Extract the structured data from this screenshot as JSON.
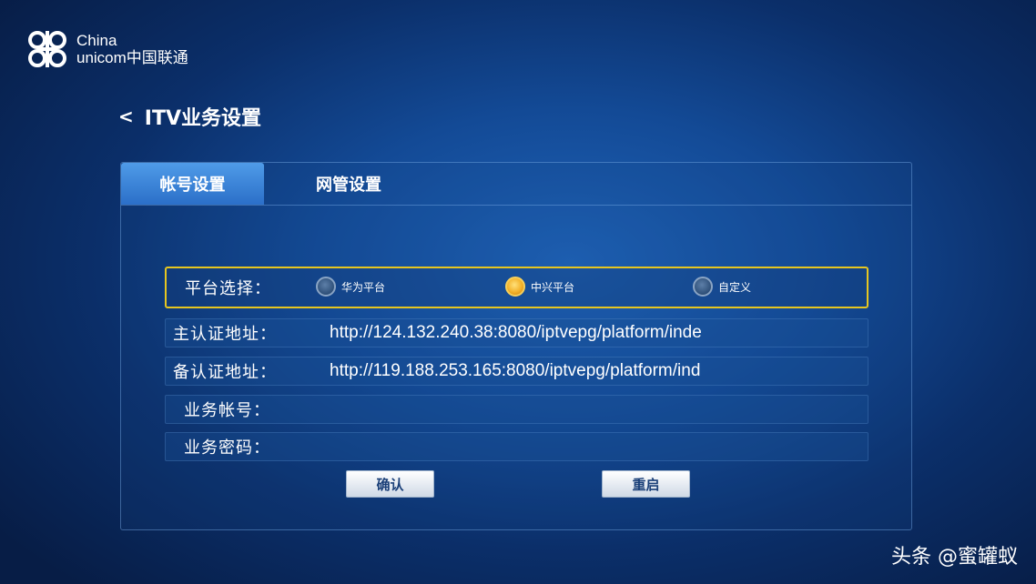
{
  "brand": {
    "line1": "China",
    "line2": "unicom中国联通",
    "logo_icon": "china-unicom-knot"
  },
  "header": {
    "back_icon": "<",
    "title": "ITV业务设置"
  },
  "tabs": [
    {
      "label": "帐号设置",
      "active": true
    },
    {
      "label": "网管设置",
      "active": false
    }
  ],
  "form": {
    "platform": {
      "label": "平台选择：",
      "options": [
        {
          "label": "华为平台",
          "selected": false
        },
        {
          "label": "中兴平台",
          "selected": true
        },
        {
          "label": "自定义",
          "selected": false
        }
      ]
    },
    "primary_auth": {
      "label": "主认证地址：",
      "value": "http://124.132.240.38:8080/iptvepg/platform/inde"
    },
    "backup_auth": {
      "label": "备认证地址：",
      "value": "http://119.188.253.165:8080/iptvepg/platform/ind"
    },
    "account": {
      "label": "业务帐号：",
      "value": ""
    },
    "password": {
      "label": "业务密码：",
      "value": ""
    }
  },
  "buttons": {
    "confirm": "确认",
    "restart": "重启"
  },
  "watermark": "头条 @蜜罐蚁",
  "colors": {
    "accent_tab": "#3b86d8",
    "focus_border": "#e6c620",
    "selected_radio": "#f3b22a"
  }
}
